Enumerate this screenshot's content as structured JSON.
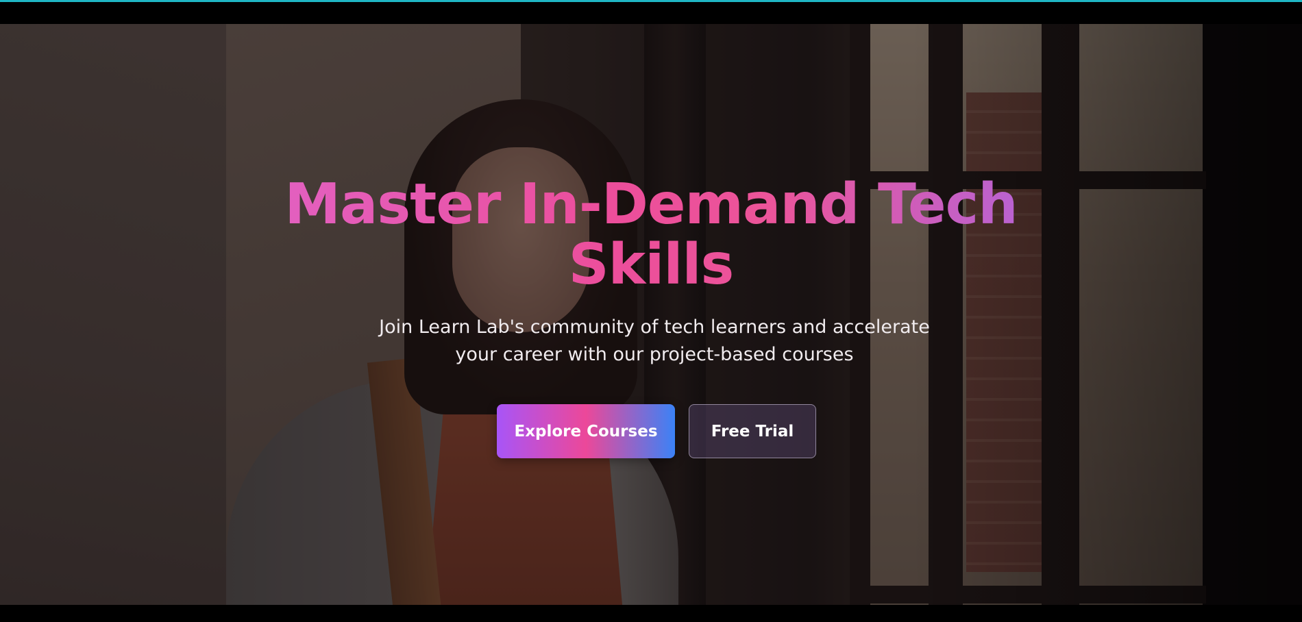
{
  "hero": {
    "title": "Master In-Demand Tech Skills",
    "subtitle": "Join Learn Lab's community of tech learners and accelerate your career with our project-based courses",
    "primary_button_label": "Explore Courses",
    "secondary_button_label": "Free Trial"
  },
  "colors": {
    "accent_top_border": "#1fb6c4",
    "title_gradient": [
      "#e261c2",
      "#ec4e9b",
      "#b564d6"
    ],
    "primary_button_gradient": [
      "#a855f7",
      "#ec4899",
      "#3b82f6"
    ]
  },
  "background_image": "woman-with-backpack-by-window-photo"
}
